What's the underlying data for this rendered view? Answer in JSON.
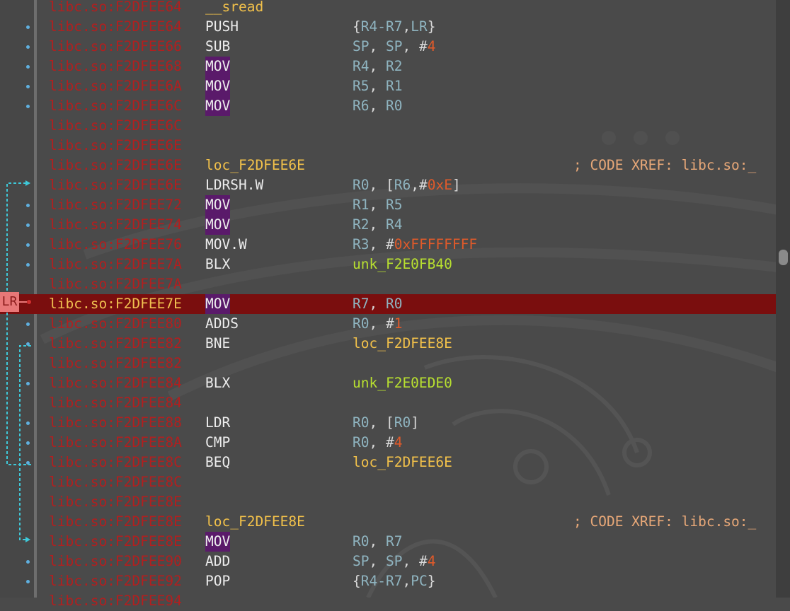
{
  "current_row_index": 15,
  "lr_marker": "LR",
  "rows": [
    {
      "address": "libc.so:F2DFEE64",
      "mnemonic": "__sread",
      "kind": "name",
      "operands": "",
      "comment": "",
      "dot": false
    },
    {
      "address": "libc.so:F2DFEE64",
      "mnemonic": "PUSH",
      "kind": "plain",
      "operands": "{R4-R7,LR}",
      "comment": "",
      "dot": true
    },
    {
      "address": "libc.so:F2DFEE66",
      "mnemonic": "SUB",
      "kind": "plain",
      "operands": "SP, SP, #4",
      "comment": "",
      "dot": true
    },
    {
      "address": "libc.so:F2DFEE68",
      "mnemonic": "MOV",
      "kind": "hl",
      "operands": "R4, R2",
      "comment": "",
      "dot": true
    },
    {
      "address": "libc.so:F2DFEE6A",
      "mnemonic": "MOV",
      "kind": "hl",
      "operands": "R5, R1",
      "comment": "",
      "dot": true
    },
    {
      "address": "libc.so:F2DFEE6C",
      "mnemonic": "MOV",
      "kind": "hl",
      "operands": "R6, R0",
      "comment": "",
      "dot": true
    },
    {
      "address": "libc.so:F2DFEE6C",
      "mnemonic": "",
      "kind": "plain",
      "operands": "",
      "comment": "",
      "dot": false
    },
    {
      "address": "libc.so:F2DFEE6E",
      "mnemonic": "",
      "kind": "plain",
      "operands": "",
      "comment": "",
      "dot": false
    },
    {
      "address": "libc.so:F2DFEE6E",
      "mnemonic": "loc_F2DFEE6E",
      "kind": "name",
      "operands": "",
      "comment": "; CODE XREF: libc.so:_",
      "dot": false
    },
    {
      "address": "libc.so:F2DFEE6E",
      "mnemonic": "LDRSH.W",
      "kind": "plain",
      "operands": "R0, [R6,#0xE]",
      "comment": "",
      "dot": false
    },
    {
      "address": "libc.so:F2DFEE72",
      "mnemonic": "MOV",
      "kind": "hl",
      "operands": "R1, R5",
      "comment": "",
      "dot": true
    },
    {
      "address": "libc.so:F2DFEE74",
      "mnemonic": "MOV",
      "kind": "hl",
      "operands": "R2, R4",
      "comment": "",
      "dot": true
    },
    {
      "address": "libc.so:F2DFEE76",
      "mnemonic": "MOV.W",
      "kind": "plain",
      "operands": "R3, #0xFFFFFFFF",
      "comment": "",
      "dot": true
    },
    {
      "address": "libc.so:F2DFEE7A",
      "mnemonic": "BLX",
      "kind": "plain",
      "operands": "unk_F2E0FB40",
      "comment": "",
      "dot": true
    },
    {
      "address": "libc.so:F2DFEE7A",
      "mnemonic": "",
      "kind": "plain",
      "operands": "",
      "comment": "",
      "dot": false
    },
    {
      "address": "libc.so:F2DFEE7E",
      "mnemonic": "MOV",
      "kind": "hl",
      "operands": "R7, R0",
      "comment": "",
      "dot": false
    },
    {
      "address": "libc.so:F2DFEE80",
      "mnemonic": "ADDS",
      "kind": "plain",
      "operands": "R0, #1",
      "comment": "",
      "dot": true
    },
    {
      "address": "libc.so:F2DFEE82",
      "mnemonic": "BNE",
      "kind": "plain",
      "operands": "loc_F2DFEE8E",
      "comment": "",
      "dot": true
    },
    {
      "address": "libc.so:F2DFEE82",
      "mnemonic": "",
      "kind": "plain",
      "operands": "",
      "comment": "",
      "dot": false
    },
    {
      "address": "libc.so:F2DFEE84",
      "mnemonic": "BLX",
      "kind": "plain",
      "operands": "unk_F2E0EDE0",
      "comment": "",
      "dot": true
    },
    {
      "address": "libc.so:F2DFEE84",
      "mnemonic": "",
      "kind": "plain",
      "operands": "",
      "comment": "",
      "dot": false
    },
    {
      "address": "libc.so:F2DFEE88",
      "mnemonic": "LDR",
      "kind": "plain",
      "operands": "R0, [R0]",
      "comment": "",
      "dot": true
    },
    {
      "address": "libc.so:F2DFEE8A",
      "mnemonic": "CMP",
      "kind": "plain",
      "operands": "R0, #4",
      "comment": "",
      "dot": true
    },
    {
      "address": "libc.so:F2DFEE8C",
      "mnemonic": "BEQ",
      "kind": "plain",
      "operands": "loc_F2DFEE6E",
      "comment": "",
      "dot": true
    },
    {
      "address": "libc.so:F2DFEE8C",
      "mnemonic": "",
      "kind": "plain",
      "operands": "",
      "comment": "",
      "dot": false
    },
    {
      "address": "libc.so:F2DFEE8E",
      "mnemonic": "",
      "kind": "plain",
      "operands": "",
      "comment": "",
      "dot": false
    },
    {
      "address": "libc.so:F2DFEE8E",
      "mnemonic": "loc_F2DFEE8E",
      "kind": "name",
      "operands": "",
      "comment": "; CODE XREF: libc.so:_",
      "dot": false
    },
    {
      "address": "libc.so:F2DFEE8E",
      "mnemonic": "MOV",
      "kind": "hl",
      "operands": "R0, R7",
      "comment": "",
      "dot": false
    },
    {
      "address": "libc.so:F2DFEE90",
      "mnemonic": "ADD",
      "kind": "plain",
      "operands": "SP, SP, #4",
      "comment": "",
      "dot": true
    },
    {
      "address": "libc.so:F2DFEE92",
      "mnemonic": "POP",
      "kind": "plain",
      "operands": "{R4-R7,PC}",
      "comment": "",
      "dot": true
    },
    {
      "address": "libc.so:F2DFEE94",
      "mnemonic": "",
      "kind": "plain",
      "operands": "",
      "comment": "",
      "dot": false
    }
  ],
  "colors": {
    "background": "#4a4a4a",
    "address": "#b21f1f",
    "current_row": "#7a0e0e",
    "mnemonic_highlight": "#5a1a6a",
    "label": "#f2c14a",
    "function": "#b8e030",
    "immediate": "#e05a2a",
    "register": "#8fb4c0",
    "comment": "#e8a878",
    "flow_arrow": "#3ec8d8"
  }
}
